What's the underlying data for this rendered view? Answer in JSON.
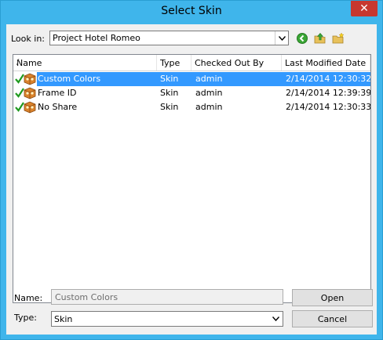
{
  "window": {
    "title": "Select Skin"
  },
  "lookin": {
    "label": "Look in:",
    "value": "Project Hotel Romeo"
  },
  "toolbar": {
    "back_icon": "back-arrow-icon",
    "up_icon": "up-folder-icon",
    "new_folder_icon": "new-folder-icon"
  },
  "list": {
    "columns": [
      "Name",
      "Type",
      "Checked Out By",
      "Last Modified Date"
    ],
    "sort_glyph": "/",
    "rows": [
      {
        "name": "Custom Colors",
        "type": "Skin",
        "checked_out_by": "admin",
        "modified": "2/14/2014 12:30:32...",
        "selected": true
      },
      {
        "name": "Frame ID",
        "type": "Skin",
        "checked_out_by": "admin",
        "modified": "2/14/2014 12:39:39...",
        "selected": false
      },
      {
        "name": "No Share",
        "type": "Skin",
        "checked_out_by": "admin",
        "modified": "2/14/2014 12:30:33...",
        "selected": false
      }
    ]
  },
  "name_field": {
    "label": "Name:",
    "value": "Custom Colors"
  },
  "type_field": {
    "label": "Type:",
    "value": "Skin"
  },
  "buttons": {
    "open": "Open",
    "cancel": "Cancel"
  },
  "colors": {
    "titlebar": "#3fb5eb",
    "close": "#c7372f",
    "selection": "#3399ff"
  }
}
